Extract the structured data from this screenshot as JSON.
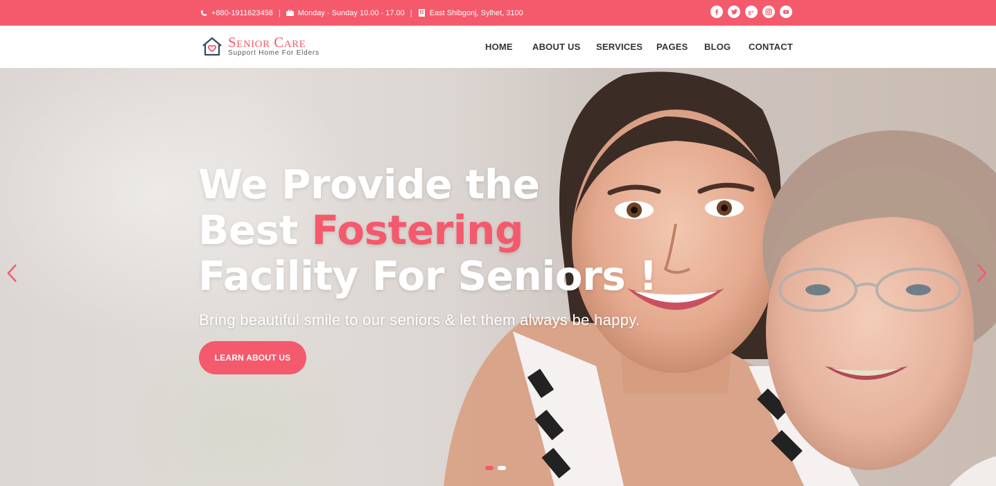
{
  "topbar": {
    "phone": "+880-1911623458",
    "hours": "Monday - Sunday 10.00 - 17.00",
    "address": "East Shibgonj, Sylhet, 3100",
    "separator": "|",
    "icons": [
      "phone-icon",
      "briefcase-icon",
      "building-icon"
    ],
    "social": [
      "facebook-icon",
      "twitter-icon",
      "google-plus-icon",
      "instagram-icon",
      "youtube-icon"
    ]
  },
  "brand": {
    "name": "Senior Care",
    "tagline": "Support Home For Elders",
    "icon": "house-heart-icon"
  },
  "nav": {
    "items": [
      "HOME",
      "ABOUT US",
      "SERVICES",
      "PAGES",
      "BLOG",
      "CONTACT"
    ]
  },
  "hero": {
    "line1": "We Provide the",
    "line2_pre": "Best ",
    "line2_accent": "Fostering",
    "line3": "Facility For Seniors !",
    "subline": "Bring beautiful smile to our seniors & let them always be happy.",
    "cta": "LEARN ABOUT US",
    "prev_icon": "chevron-left-icon",
    "next_icon": "chevron-right-icon",
    "slides_total": 2,
    "active_slide": 1
  },
  "colors": {
    "accent": "#f5596c",
    "text_dark": "#333333",
    "white": "#ffffff"
  }
}
